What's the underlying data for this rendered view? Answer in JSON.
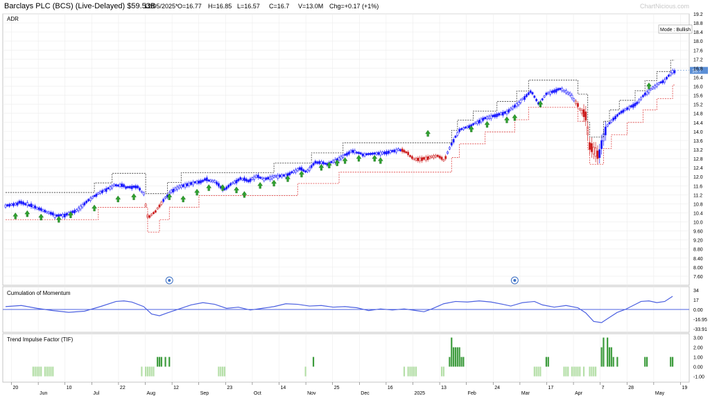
{
  "header": {
    "title": "Barclays PLC (BCS) (Live-Delayed) $59.53B",
    "date": "12/05/2025*",
    "open": "O=16.77",
    "high": "H=16.85",
    "low": "L=16.57",
    "close": "C=16.7",
    "volume": "V=13.0M",
    "change": "Chg=+0.17 (+1%)",
    "watermark": "ChartNicious.com"
  },
  "colors": {
    "up": "#1a1aff",
    "down": "#cc1f1f",
    "arrow": "#2fa12f",
    "stop_bull": "#333333",
    "stop_bear": "#e04040",
    "momentum": "#4a5fe0",
    "tif_strong": "#3c9b3c",
    "tif_weak": "#b5dfa8",
    "price_tag": "#5b8fd6"
  },
  "chart_data": [
    {
      "type": "candlestick",
      "title": "ADR",
      "mode_label": "Mode : Bullish",
      "current_price_label": "16.7",
      "ylim": [
        7.2,
        19.2
      ],
      "y_ticks": [
        "7.60",
        "8.00",
        "8.40",
        "8.80",
        "9.20",
        "9.60",
        "10.0",
        "10.4",
        "10.8",
        "11.2",
        "11.6",
        "12.0",
        "12.4",
        "12.8",
        "13.2",
        "13.6",
        "14.0",
        "14.4",
        "14.8",
        "15.2",
        "15.6",
        "16.0",
        "16.4",
        "16.8",
        "17.2",
        "17.6",
        "18.0",
        "18.4",
        "18.8",
        "19.2"
      ],
      "x_date_ticks": [
        "20",
        "Jun",
        "10",
        "Jul",
        "22",
        "Aug",
        "12",
        "Sep",
        "23",
        "Oct",
        "14",
        "Nov",
        "25",
        "Dec",
        "16",
        "2025",
        "13",
        "Feb",
        "24",
        "Mar",
        "17",
        "Apr",
        "7",
        "28",
        "May",
        "19"
      ],
      "close_path": [
        [
          0,
          10.75
        ],
        [
          6,
          10.85
        ],
        [
          12,
          10.7
        ],
        [
          18,
          10.5
        ],
        [
          24,
          10.3
        ],
        [
          30,
          10.35
        ],
        [
          36,
          10.55
        ],
        [
          42,
          11.0
        ],
        [
          48,
          11.35
        ],
        [
          54,
          11.6
        ],
        [
          60,
          11.55
        ],
        [
          66,
          11.6
        ],
        [
          70,
          11.2
        ],
        [
          72,
          10.2
        ],
        [
          76,
          10.5
        ],
        [
          80,
          11.0
        ],
        [
          84,
          11.4
        ],
        [
          88,
          11.6
        ],
        [
          94,
          11.75
        ],
        [
          100,
          11.85
        ],
        [
          106,
          11.75
        ],
        [
          110,
          11.4
        ],
        [
          114,
          11.7
        ],
        [
          118,
          11.9
        ],
        [
          122,
          11.8
        ],
        [
          126,
          12.0
        ],
        [
          130,
          11.9
        ],
        [
          136,
          12.05
        ],
        [
          142,
          12.1
        ],
        [
          148,
          12.35
        ],
        [
          152,
          12.2
        ],
        [
          156,
          12.6
        ],
        [
          162,
          12.55
        ],
        [
          168,
          12.8
        ],
        [
          174,
          13.1
        ],
        [
          180,
          13.0
        ],
        [
          186,
          13.05
        ],
        [
          192,
          13.1
        ],
        [
          198,
          13.2
        ],
        [
          203,
          13.05
        ],
        [
          206,
          12.8
        ],
        [
          212,
          12.85
        ],
        [
          218,
          12.95
        ],
        [
          222,
          12.7
        ],
        [
          226,
          13.5
        ],
        [
          230,
          14.1
        ],
        [
          236,
          14.3
        ],
        [
          242,
          14.6
        ],
        [
          248,
          14.75
        ],
        [
          254,
          14.9
        ],
        [
          260,
          15.3
        ],
        [
          266,
          15.8
        ],
        [
          270,
          15.2
        ],
        [
          274,
          15.7
        ],
        [
          280,
          15.9
        ],
        [
          286,
          15.6
        ],
        [
          290,
          15.1
        ],
        [
          294,
          14.5
        ],
        [
          296,
          13.2
        ],
        [
          300,
          12.8
        ],
        [
          302,
          13.6
        ],
        [
          304,
          14.2
        ],
        [
          308,
          14.6
        ],
        [
          312,
          14.9
        ],
        [
          316,
          15.1
        ],
        [
          320,
          15.3
        ],
        [
          324,
          15.7
        ],
        [
          330,
          16.1
        ],
        [
          334,
          16.3
        ],
        [
          338,
          16.7
        ]
      ],
      "buy_signal_days": [
        5,
        11,
        18,
        27,
        33,
        45,
        57,
        65,
        83,
        90,
        97,
        103,
        110,
        117,
        121,
        129,
        136,
        143,
        150,
        160,
        164,
        168,
        172,
        179,
        187,
        190,
        214,
        236,
        244,
        254,
        258,
        271,
        326
      ],
      "arrow_anchor_price": [
        10.25,
        10.35,
        10.2,
        10.1,
        10.3,
        10.6,
        11.0,
        11.1,
        11.1,
        11.0,
        11.3,
        11.5,
        11.5,
        11.4,
        11.2,
        11.6,
        11.7,
        11.9,
        12.1,
        12.4,
        12.5,
        12.6,
        12.7,
        12.8,
        12.8,
        12.7,
        13.9,
        14.1,
        14.3,
        14.5,
        14.6,
        15.2,
        16.0
      ]
    },
    {
      "type": "line",
      "title": "Cumulation of Momentum",
      "ylim": [
        -40,
        40
      ],
      "y_ticks": [
        "34",
        "17",
        "0.00",
        "-16.95",
        "-33.91"
      ],
      "reference_line": 0,
      "values": [
        [
          0,
          5
        ],
        [
          8,
          7
        ],
        [
          16,
          2
        ],
        [
          24,
          -2
        ],
        [
          32,
          -5
        ],
        [
          40,
          -3
        ],
        [
          48,
          5
        ],
        [
          56,
          14
        ],
        [
          60,
          15
        ],
        [
          64,
          13
        ],
        [
          70,
          5
        ],
        [
          74,
          -8
        ],
        [
          78,
          -11
        ],
        [
          82,
          -6
        ],
        [
          88,
          1
        ],
        [
          94,
          8
        ],
        [
          100,
          12
        ],
        [
          106,
          9
        ],
        [
          112,
          2
        ],
        [
          118,
          4
        ],
        [
          124,
          -1
        ],
        [
          130,
          2
        ],
        [
          136,
          5
        ],
        [
          142,
          10
        ],
        [
          148,
          9
        ],
        [
          154,
          6
        ],
        [
          160,
          7
        ],
        [
          166,
          4
        ],
        [
          172,
          5
        ],
        [
          178,
          3
        ],
        [
          184,
          -2
        ],
        [
          190,
          1
        ],
        [
          196,
          -1
        ],
        [
          202,
          1
        ],
        [
          208,
          -2
        ],
        [
          212,
          -4
        ],
        [
          216,
          1
        ],
        [
          222,
          10
        ],
        [
          228,
          14
        ],
        [
          234,
          13
        ],
        [
          240,
          15
        ],
        [
          246,
          13
        ],
        [
          252,
          9
        ],
        [
          256,
          6
        ],
        [
          262,
          12
        ],
        [
          268,
          14
        ],
        [
          272,
          8
        ],
        [
          278,
          4
        ],
        [
          284,
          7
        ],
        [
          290,
          3
        ],
        [
          294,
          -6
        ],
        [
          298,
          -21
        ],
        [
          302,
          -23
        ],
        [
          306,
          -14
        ],
        [
          310,
          -5
        ],
        [
          314,
          0
        ],
        [
          318,
          7
        ],
        [
          322,
          14
        ],
        [
          326,
          15
        ],
        [
          330,
          12
        ],
        [
          334,
          14
        ],
        [
          338,
          23
        ]
      ]
    },
    {
      "type": "bar",
      "title": "Trend Impulse Factor (TIF)",
      "ylim": [
        -1.6,
        3.4
      ],
      "y_ticks": [
        "3.00",
        "2.00",
        "1.00",
        "0.00",
        "-1.00"
      ]
    }
  ]
}
